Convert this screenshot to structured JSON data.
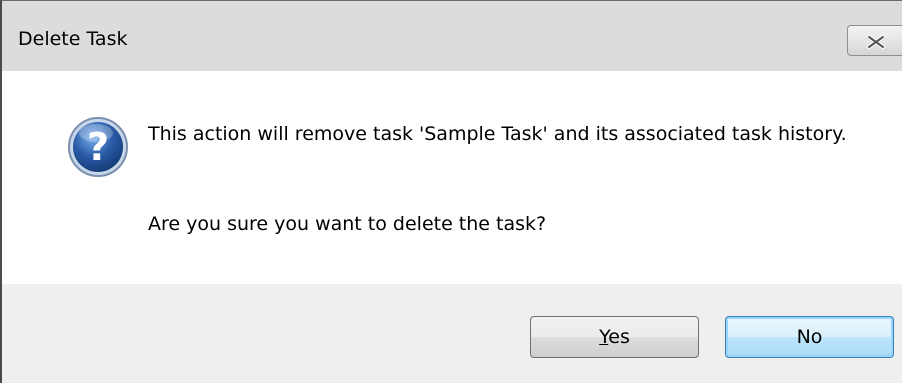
{
  "window": {
    "title": "Delete Task",
    "close_icon": "close-icon"
  },
  "message": {
    "icon": "question-icon",
    "line1": "This action will remove task 'Sample Task' and its associated task history.",
    "line2": "Are you sure you want to delete the task?"
  },
  "buttons": {
    "yes_mnemonic": "Y",
    "yes_rest": "es",
    "no_label": "No"
  },
  "colors": {
    "question_icon_fill": "#2a5ca8",
    "default_button_border": "#3c7fb1"
  }
}
